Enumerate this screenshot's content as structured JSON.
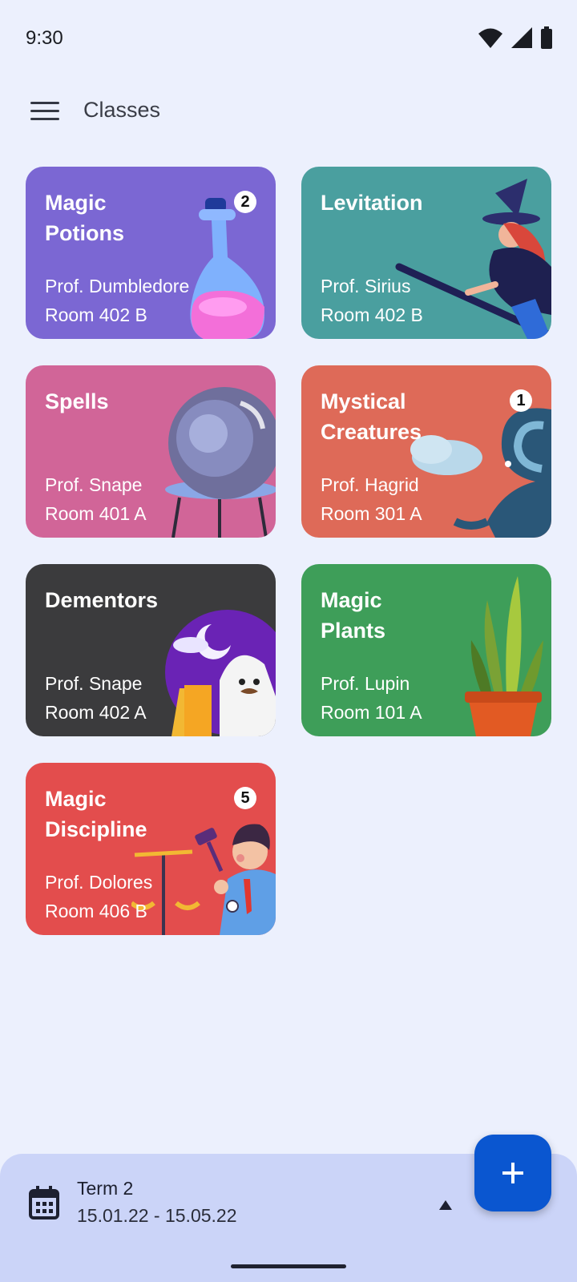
{
  "status": {
    "time": "9:30"
  },
  "header": {
    "title": "Classes"
  },
  "classes": [
    {
      "title": "Magic\nPotions",
      "professor": "Prof. Dumbledore",
      "room": "Room 402 B",
      "badge": "2",
      "color": "#7b67d3",
      "illustration": "potion-flask-icon"
    },
    {
      "title": "Levitation",
      "professor": "Prof. Sirius",
      "room": "Room 402 B",
      "badge": "",
      "color": "#4a9f9f",
      "illustration": "witch-on-broom-icon"
    },
    {
      "title": "Spells",
      "professor": "Prof. Snape",
      "room": "Room 401 A",
      "badge": "",
      "color": "#d16598",
      "illustration": "crystal-ball-icon"
    },
    {
      "title": "Mystical\nCreatures",
      "professor": "Prof. Hagrid",
      "room": "Room 301 A",
      "badge": "1",
      "color": "#de6a58",
      "illustration": "dragon-icon"
    },
    {
      "title": "Dementors",
      "professor": "Prof. Snape",
      "room": "Room 402 A",
      "badge": "",
      "color": "#3b3b3d",
      "illustration": "ghost-night-icon"
    },
    {
      "title": "Magic\nPlants",
      "professor": "Prof. Lupin",
      "room": "Room 101 A",
      "badge": "",
      "color": "#3e9e59",
      "illustration": "potted-plant-icon"
    },
    {
      "title": "Magic\nDiscipline",
      "professor": "Prof. Dolores",
      "room": "Room 406 B",
      "badge": "5",
      "color": "#e34d4d",
      "illustration": "judge-gavel-icon"
    }
  ],
  "term": {
    "title": "Term 2",
    "dates": "15.01.22 - 15.05.22"
  },
  "fab": {
    "icon": "plus-icon",
    "color": "#0a56d0"
  }
}
